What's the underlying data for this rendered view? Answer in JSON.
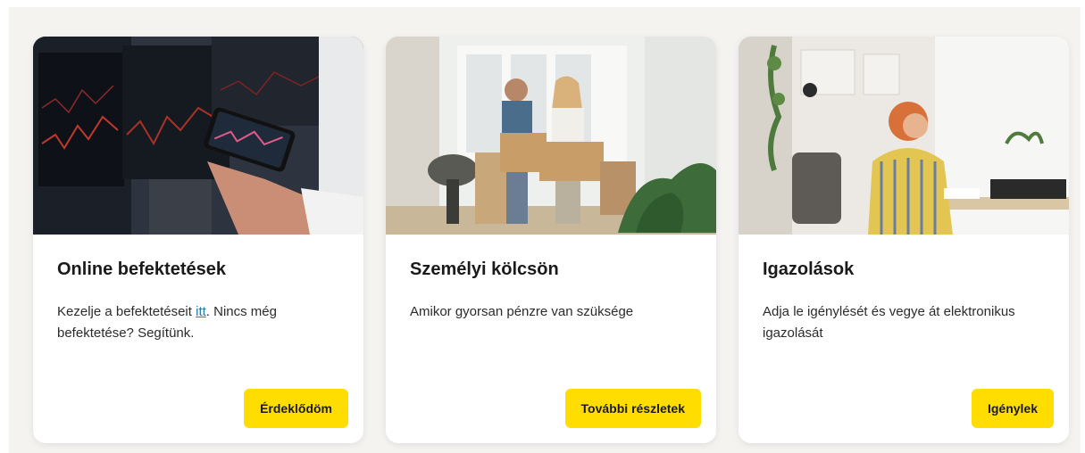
{
  "cards": [
    {
      "title": "Online befektetések",
      "text_before": "Kezelje a befektetéseit ",
      "link": "itt",
      "text_after": ". Nincs még befektetése? Segítünk.",
      "button": "Érdeklődöm",
      "image": "trading-phone-photo"
    },
    {
      "title": "Személyi kölcsön",
      "text": "Amikor gyorsan pénzre van szüksége",
      "button": "További részletek",
      "image": "couple-moving-boxes-photo"
    },
    {
      "title": "Igazolások",
      "text": "Adja le igénylését és vegye át elektronikus igazolását",
      "button": "Igénylek",
      "image": "woman-working-home-photo"
    }
  ],
  "colors": {
    "accent": "#ffdd00",
    "link": "#1d7fa8",
    "background": "#f4f3f0",
    "card": "#ffffff"
  }
}
